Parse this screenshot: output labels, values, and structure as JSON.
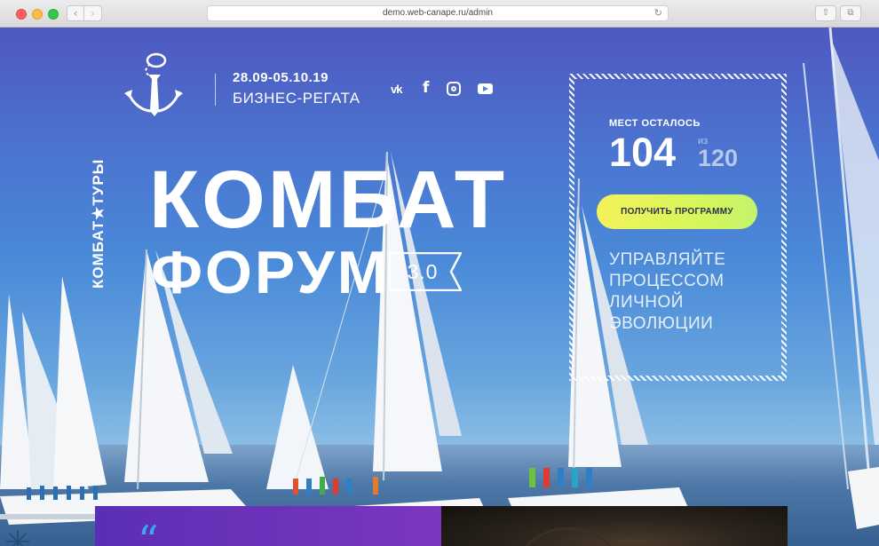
{
  "browser": {
    "url": "demo.web-canape.ru/admin",
    "back_glyph": "‹",
    "forward_glyph": "›",
    "reload_glyph": "↻",
    "share_glyph": "⇧",
    "tabs_glyph": "⧉"
  },
  "header": {
    "date": "28.09-05.10.19",
    "event_name": "БИЗНЕС-РЕГАТА",
    "social": {
      "vk": "vk",
      "facebook": "f"
    }
  },
  "brand": {
    "vertical_text": "КОМБАТ★ТУРЫ"
  },
  "hero": {
    "title_line1": "КОМБАТ",
    "title_line2": "ФОРУМ",
    "version": "3.0"
  },
  "seats": {
    "label": "МЕСТ ОСТАЛОСЬ",
    "remaining": "104",
    "of_label": "из",
    "total": "120",
    "cta_label": "ПОЛУЧИТЬ ПРОГРАММУ",
    "slogan_lines": [
      "УПРАВЛЯЙТЕ",
      "ПРОЦЕССОМ",
      "ЛИЧНОЙ",
      "ЭВОЛЮЦИИ"
    ]
  },
  "quote": {
    "mark": "“"
  },
  "colors": {
    "accent_yellow": "#f4f25a",
    "accent_purple": "#6a33bb",
    "quote_blue": "#3fa6f0"
  }
}
